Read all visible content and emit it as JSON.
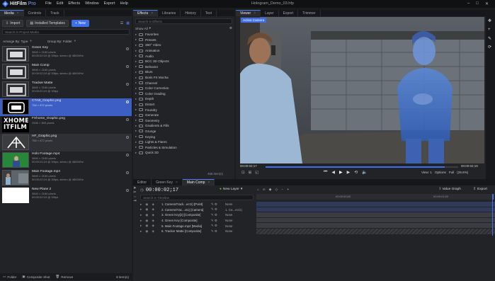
{
  "app": {
    "name_bold": "HitFilm",
    "name_suffix": "Pro",
    "document": "Hologram_Demo_03.hfp"
  },
  "menu": [
    "File",
    "Edit",
    "Effects",
    "Window",
    "Export",
    "Help"
  ],
  "media_panel": {
    "tabs": [
      {
        "label": "Media"
      },
      {
        "label": "Controls"
      },
      {
        "label": "Track"
      }
    ],
    "import_label": "Import",
    "templates_label": "Installed Templates",
    "new_label": "New",
    "search_placeholder": "Search in Project Media",
    "arrange_label": "Arrange By: Type",
    "group_label": "Group By: Folder",
    "items": [
      {
        "name": "Green Key",
        "detail1": "3840 × 2160 pixels",
        "detail2": "00:00:02;19 @ 30fps, stereo @ 48000Hz"
      },
      {
        "name": "Main Comp",
        "detail1": "3840 × 2160 pixels",
        "detail2": "00:00:02;19 @ 30fps, stereo @ 48000Hz"
      },
      {
        "name": "Tracker Matte",
        "detail1": "3840 × 2160 pixels",
        "detail2": "00:00:02;19 @ 30fps"
      },
      {
        "name": "CTAB_Graphic.png",
        "detail1": "768 × 872 pixels",
        "detail2": ""
      },
      {
        "name": "FXhome_Graphic.png",
        "detail1": "2546 × 800 pixels",
        "detail2": ""
      },
      {
        "name": "HF_Graphic.png",
        "detail1": "768 × 872 pixels",
        "detail2": ""
      },
      {
        "name": "Holo Footage.mp4",
        "detail1": "3840 × 2160 pixels",
        "detail2": "00:00:02;19 @ 30fps, stereo @ 48000Hz"
      },
      {
        "name": "Main Footage.mp4",
        "detail1": "3840 × 2160 pixels",
        "detail2": "00:00:02;19 @ 30fps, stereo @ 48000Hz"
      },
      {
        "name": "New Plane 2",
        "detail1": "3840 × 2160 pixels",
        "detail2": "00:00:02;19 @ 30fps"
      }
    ],
    "fxhome_logo_lines": [
      "XHOME",
      "ITFILM"
    ],
    "footer": {
      "folder": "Folder",
      "composite": "Composite Shot",
      "remove": "Remove",
      "count": "9 item(s)"
    }
  },
  "effects_panel": {
    "tabs": [
      {
        "label": "Effects"
      },
      {
        "label": "Libraries"
      },
      {
        "label": "History"
      },
      {
        "label": "Text"
      }
    ],
    "search_placeholder": "Search in Effects",
    "show_label": "Show All",
    "categories": [
      "Favorites",
      "Presets",
      "360° Video",
      "Animation",
      "Audio",
      "BCC 3D Objects",
      "Behavior",
      "Blurs",
      "Boris FX Mocha",
      "Channel",
      "Color Correction",
      "Color Grading",
      "Depth",
      "Distort",
      "Foundry",
      "Generate",
      "Geometry",
      "Gradients & Fills",
      "Grunge",
      "Keying",
      "Lights & Flares",
      "Particles & Simulation",
      "Quick 3D"
    ],
    "count": "465 item(s)"
  },
  "viewer_panel": {
    "tabs": [
      {
        "label": "Viewer"
      },
      {
        "label": "Layer"
      },
      {
        "label": "Export"
      },
      {
        "label": "Trimmer"
      }
    ],
    "camera_label": "Active Camera",
    "timecode_start": "00:00:02;17",
    "timecode_end": "00:00:02;19",
    "view_label": "View: 1",
    "options_label": "Options",
    "full_label": "Full",
    "zoom_label": "(25.6%)",
    "playhead_fraction": 0.93
  },
  "editor_panel": {
    "tabs": [
      {
        "label": "Editor"
      },
      {
        "label": "Green Key"
      },
      {
        "label": "Main Comp"
      }
    ],
    "timecode": "00:00:02;17",
    "new_layer_label": "New Layer",
    "search_placeholder": "Search in Timeline",
    "value_graph_label": "Value Graph",
    "export_label": "Export",
    "ruler": [
      "00:00:00;00",
      "00:00:01;00"
    ],
    "layers": [
      {
        "name": "1. CameraTrack...ect1) [Point]",
        "mode": "",
        "parent": "None"
      },
      {
        "name": "2. CameraTrac...ct1) [Camera]",
        "mode": "",
        "parent": "1. Ca...ect1)"
      },
      {
        "name": "3. Green Key[2] [Composite]",
        "mode": "",
        "parent": "None"
      },
      {
        "name": "4. Green Key [Composite]",
        "mode": "",
        "parent": "None"
      },
      {
        "name": "5. Main Footage.mp4 [Media]",
        "mode": "",
        "parent": "None"
      },
      {
        "name": "6. Tracker Matte [Composite]",
        "mode": "",
        "parent": "None"
      }
    ]
  },
  "colors": {
    "accent": "#3f6fe8",
    "selection": "#3d5ec4",
    "panel": "#222326",
    "green": "#5ec43d"
  }
}
